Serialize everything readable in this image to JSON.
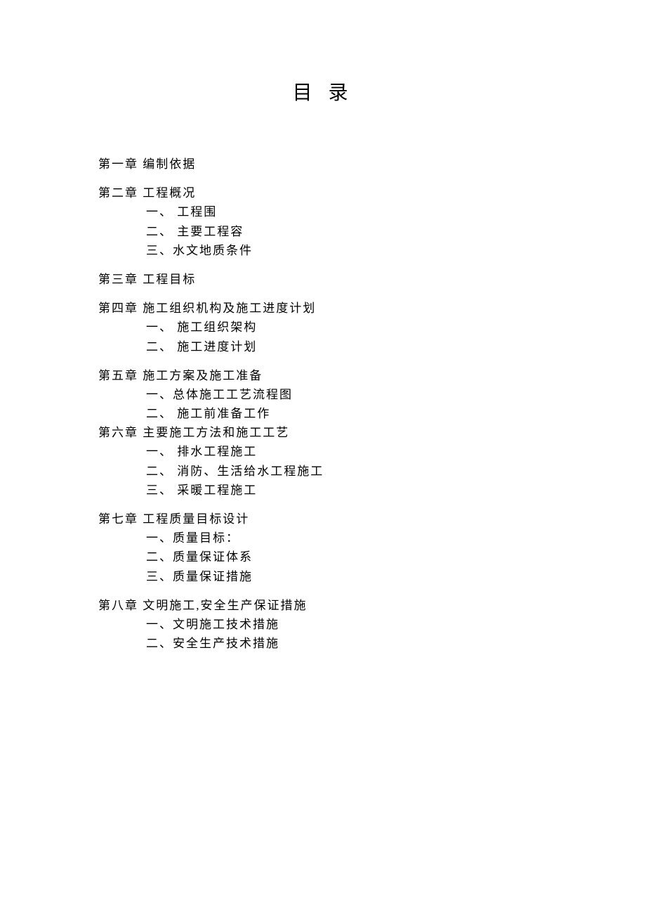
{
  "title": "目 录",
  "chapters": [
    {
      "heading": "第一章  编制依据",
      "items": []
    },
    {
      "heading": "第二章  工程概况",
      "items": [
        "一、  工程围",
        "二、  主要工程容",
        "三、水文地质条件"
      ]
    },
    {
      "heading": "第三章  工程目标",
      "items": []
    },
    {
      "heading": "第四章  施工组织机构及施工进度计划",
      "items": [
        "一、  施工组织架构",
        "二、  施工进度计划"
      ]
    },
    {
      "heading": "第五章  施工方案及施工准备",
      "items": [
        "一、总体施工工艺流程图",
        "二、  施工前准备工作"
      ],
      "noBottomMargin": true
    },
    {
      "heading": "第六章  主要施工方法和施工工艺",
      "items": [
        "一、  排水工程施工",
        "二、  消防、生活给水工程施工",
        "三、  采暖工程施工"
      ]
    },
    {
      "heading": "第七章  工程质量目标设计",
      "items": [
        "一、质量目标：",
        "二、质量保证体系",
        "三、质量保证措施"
      ]
    },
    {
      "heading": "第八章  文明施工,安全生产保证措施",
      "items": [
        "一、文明施工技术措施",
        "二、安全生产技术措施"
      ]
    }
  ]
}
